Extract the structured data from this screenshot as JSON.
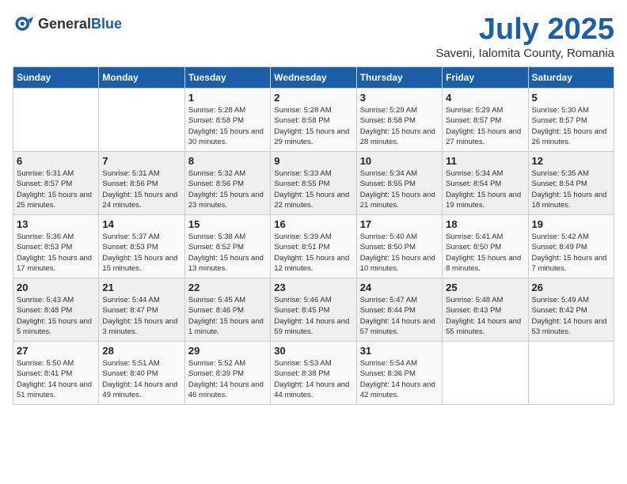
{
  "logo": {
    "general": "General",
    "blue": "Blue"
  },
  "title": "July 2025",
  "subtitle": "Saveni, Ialomita County, Romania",
  "weekdays": [
    "Sunday",
    "Monday",
    "Tuesday",
    "Wednesday",
    "Thursday",
    "Friday",
    "Saturday"
  ],
  "weeks": [
    [
      {
        "day": "",
        "info": ""
      },
      {
        "day": "",
        "info": ""
      },
      {
        "day": "1",
        "info": "Sunrise: 5:28 AM\nSunset: 8:58 PM\nDaylight: 15 hours and 30 minutes."
      },
      {
        "day": "2",
        "info": "Sunrise: 5:28 AM\nSunset: 8:58 PM\nDaylight: 15 hours and 29 minutes."
      },
      {
        "day": "3",
        "info": "Sunrise: 5:29 AM\nSunset: 8:58 PM\nDaylight: 15 hours and 28 minutes."
      },
      {
        "day": "4",
        "info": "Sunrise: 5:29 AM\nSunset: 8:57 PM\nDaylight: 15 hours and 27 minutes."
      },
      {
        "day": "5",
        "info": "Sunrise: 5:30 AM\nSunset: 8:57 PM\nDaylight: 15 hours and 26 minutes."
      }
    ],
    [
      {
        "day": "6",
        "info": "Sunrise: 5:31 AM\nSunset: 8:57 PM\nDaylight: 15 hours and 25 minutes."
      },
      {
        "day": "7",
        "info": "Sunrise: 5:31 AM\nSunset: 8:56 PM\nDaylight: 15 hours and 24 minutes."
      },
      {
        "day": "8",
        "info": "Sunrise: 5:32 AM\nSunset: 8:56 PM\nDaylight: 15 hours and 23 minutes."
      },
      {
        "day": "9",
        "info": "Sunrise: 5:33 AM\nSunset: 8:55 PM\nDaylight: 15 hours and 22 minutes."
      },
      {
        "day": "10",
        "info": "Sunrise: 5:34 AM\nSunset: 8:55 PM\nDaylight: 15 hours and 21 minutes."
      },
      {
        "day": "11",
        "info": "Sunrise: 5:34 AM\nSunset: 8:54 PM\nDaylight: 15 hours and 19 minutes."
      },
      {
        "day": "12",
        "info": "Sunrise: 5:35 AM\nSunset: 8:54 PM\nDaylight: 15 hours and 18 minutes."
      }
    ],
    [
      {
        "day": "13",
        "info": "Sunrise: 5:36 AM\nSunset: 8:53 PM\nDaylight: 15 hours and 17 minutes."
      },
      {
        "day": "14",
        "info": "Sunrise: 5:37 AM\nSunset: 8:53 PM\nDaylight: 15 hours and 15 minutes."
      },
      {
        "day": "15",
        "info": "Sunrise: 5:38 AM\nSunset: 8:52 PM\nDaylight: 15 hours and 13 minutes."
      },
      {
        "day": "16",
        "info": "Sunrise: 5:39 AM\nSunset: 8:51 PM\nDaylight: 15 hours and 12 minutes."
      },
      {
        "day": "17",
        "info": "Sunrise: 5:40 AM\nSunset: 8:50 PM\nDaylight: 15 hours and 10 minutes."
      },
      {
        "day": "18",
        "info": "Sunrise: 5:41 AM\nSunset: 8:50 PM\nDaylight: 15 hours and 8 minutes."
      },
      {
        "day": "19",
        "info": "Sunrise: 5:42 AM\nSunset: 8:49 PM\nDaylight: 15 hours and 7 minutes."
      }
    ],
    [
      {
        "day": "20",
        "info": "Sunrise: 5:43 AM\nSunset: 8:48 PM\nDaylight: 15 hours and 5 minutes."
      },
      {
        "day": "21",
        "info": "Sunrise: 5:44 AM\nSunset: 8:47 PM\nDaylight: 15 hours and 3 minutes."
      },
      {
        "day": "22",
        "info": "Sunrise: 5:45 AM\nSunset: 8:46 PM\nDaylight: 15 hours and 1 minute."
      },
      {
        "day": "23",
        "info": "Sunrise: 5:46 AM\nSunset: 8:45 PM\nDaylight: 14 hours and 59 minutes."
      },
      {
        "day": "24",
        "info": "Sunrise: 5:47 AM\nSunset: 8:44 PM\nDaylight: 14 hours and 57 minutes."
      },
      {
        "day": "25",
        "info": "Sunrise: 5:48 AM\nSunset: 8:43 PM\nDaylight: 14 hours and 55 minutes."
      },
      {
        "day": "26",
        "info": "Sunrise: 5:49 AM\nSunset: 8:42 PM\nDaylight: 14 hours and 53 minutes."
      }
    ],
    [
      {
        "day": "27",
        "info": "Sunrise: 5:50 AM\nSunset: 8:41 PM\nDaylight: 14 hours and 51 minutes."
      },
      {
        "day": "28",
        "info": "Sunrise: 5:51 AM\nSunset: 8:40 PM\nDaylight: 14 hours and 49 minutes."
      },
      {
        "day": "29",
        "info": "Sunrise: 5:52 AM\nSunset: 8:39 PM\nDaylight: 14 hours and 46 minutes."
      },
      {
        "day": "30",
        "info": "Sunrise: 5:53 AM\nSunset: 8:38 PM\nDaylight: 14 hours and 44 minutes."
      },
      {
        "day": "31",
        "info": "Sunrise: 5:54 AM\nSunset: 8:36 PM\nDaylight: 14 hours and 42 minutes."
      },
      {
        "day": "",
        "info": ""
      },
      {
        "day": "",
        "info": ""
      }
    ]
  ]
}
